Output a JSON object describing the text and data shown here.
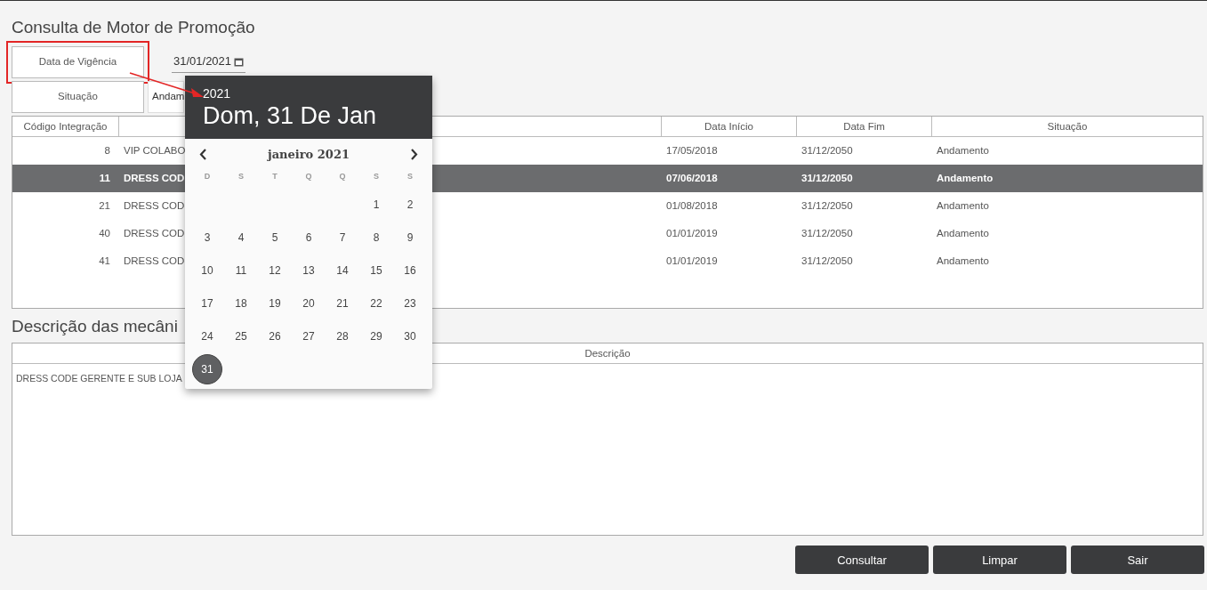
{
  "title": "Consulta de Motor de Promoção",
  "filters": [
    {
      "label": "Data de Vigência",
      "kind": "date",
      "value": "31/01/2021",
      "highlighted": true
    },
    {
      "label": "Situação",
      "kind": "select",
      "value": "Andam"
    }
  ],
  "table": {
    "columns": [
      {
        "label": "Código Integração"
      },
      {
        "kind": "blank"
      },
      {
        "label": "Data Início"
      },
      {
        "label": "Data Fim"
      },
      {
        "label": "Situação"
      }
    ],
    "rows": [
      {
        "code": "8",
        "description": "VIP COLABO",
        "start": "17/05/2018",
        "end": "31/12/2050",
        "status": "Andamento",
        "selected": false
      },
      {
        "code": "11",
        "description": "DRESS COD",
        "start": "07/06/2018",
        "end": "31/12/2050",
        "status": "Andamento",
        "selected": true
      },
      {
        "code": "21",
        "description": "DRESS COD",
        "start": "01/08/2018",
        "end": "31/12/2050",
        "status": "Andamento",
        "selected": false
      },
      {
        "code": "40",
        "description": "DRESS COD",
        "start": "01/01/2019",
        "end": "31/12/2050",
        "status": "Andamento",
        "selected": false
      },
      {
        "code": "41",
        "description": "DRESS COD",
        "start": "01/01/2019",
        "end": "31/12/2050",
        "status": "Andamento",
        "selected": false
      }
    ]
  },
  "mechanics": {
    "title": "Descrição das mecâni",
    "column": "Descrição",
    "rows": [
      "DRESS CODE GERENTE E SUB LOJA"
    ]
  },
  "datepicker": {
    "year": "2021",
    "heading": "Dom, 31 De Jan",
    "month": "janeiro 2021",
    "weekdays": [
      "D",
      "S",
      "T",
      "Q",
      "Q",
      "S",
      "S"
    ],
    "weeks": [
      {
        "days": [
          {
            "kind": "blank"
          },
          {
            "kind": "blank"
          },
          {
            "kind": "blank"
          },
          {
            "kind": "blank"
          },
          {
            "kind": "blank"
          },
          {
            "day": "1",
            "selected": false
          },
          {
            "day": "2",
            "selected": false
          }
        ]
      },
      {
        "days": [
          {
            "day": "3",
            "selected": false
          },
          {
            "day": "4",
            "selected": false
          },
          {
            "day": "5",
            "selected": false
          },
          {
            "day": "6",
            "selected": false
          },
          {
            "day": "7",
            "selected": false
          },
          {
            "day": "8",
            "selected": false
          },
          {
            "day": "9",
            "selected": false
          }
        ]
      },
      {
        "days": [
          {
            "day": "10",
            "selected": false
          },
          {
            "day": "11",
            "selected": false
          },
          {
            "day": "12",
            "selected": false
          },
          {
            "day": "13",
            "selected": false
          },
          {
            "day": "14",
            "selected": false
          },
          {
            "day": "15",
            "selected": false
          },
          {
            "day": "16",
            "selected": false
          }
        ]
      },
      {
        "days": [
          {
            "day": "17",
            "selected": false
          },
          {
            "day": "18",
            "selected": false
          },
          {
            "day": "19",
            "selected": false
          },
          {
            "day": "20",
            "selected": false
          },
          {
            "day": "21",
            "selected": false
          },
          {
            "day": "22",
            "selected": false
          },
          {
            "day": "23",
            "selected": false
          }
        ]
      },
      {
        "days": [
          {
            "day": "24",
            "selected": false
          },
          {
            "day": "25",
            "selected": false
          },
          {
            "day": "26",
            "selected": false
          },
          {
            "day": "27",
            "selected": false
          },
          {
            "day": "28",
            "selected": false
          },
          {
            "day": "29",
            "selected": false
          },
          {
            "day": "30",
            "selected": false
          }
        ]
      },
      {
        "days": [
          {
            "day": "31",
            "selected": true
          }
        ]
      }
    ]
  },
  "buttons": [
    "Consultar",
    "Limpar",
    "Sair"
  ]
}
